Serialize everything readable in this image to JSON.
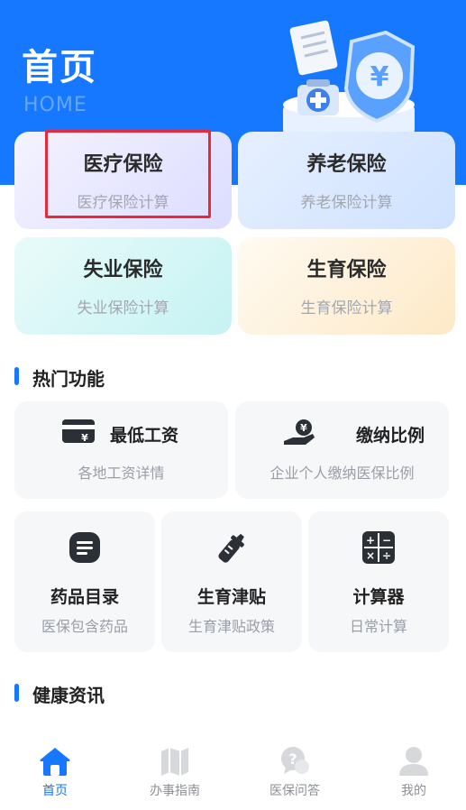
{
  "header": {
    "title": "首页",
    "subtitle": "HOME"
  },
  "insurance_cards": [
    {
      "title": "医疗保险",
      "subtitle": "医疗保险计算"
    },
    {
      "title": "养老保险",
      "subtitle": "养老保险计算"
    },
    {
      "title": "失业保险",
      "subtitle": "失业保险计算"
    },
    {
      "title": "生育保险",
      "subtitle": "生育保险计算"
    }
  ],
  "hot_features": {
    "title": "热门功能",
    "wide": [
      {
        "title": "最低工资",
        "subtitle": "各地工资详情",
        "icon": "wage-card-icon"
      },
      {
        "title": "缴纳比例",
        "subtitle": "企业个人缴纳医保比例",
        "icon": "hand-coin-icon"
      }
    ],
    "square": [
      {
        "title": "药品目录",
        "subtitle": "医保包含药品",
        "icon": "document-icon"
      },
      {
        "title": "生育津贴",
        "subtitle": "生育津贴政策",
        "icon": "baby-bottle-icon"
      },
      {
        "title": "计算器",
        "subtitle": "日常计算",
        "icon": "calculator-icon"
      }
    ]
  },
  "news": {
    "title": "健康资讯"
  },
  "tabbar": [
    {
      "label": "首页",
      "icon": "home-icon",
      "active": true
    },
    {
      "label": "办事指南",
      "icon": "map-icon",
      "active": false
    },
    {
      "label": "医保问答",
      "icon": "qa-icon",
      "active": false
    },
    {
      "label": "我的",
      "icon": "user-icon",
      "active": false
    }
  ],
  "colors": {
    "primary": "#1677ff",
    "highlight": "#e8293a"
  }
}
